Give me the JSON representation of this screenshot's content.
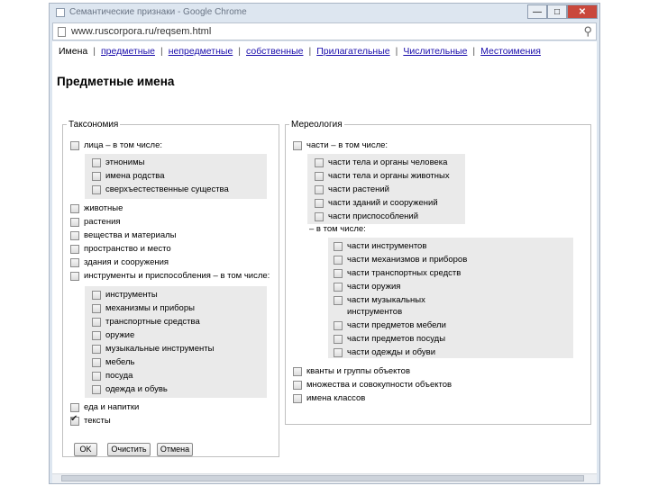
{
  "window": {
    "title": "Семантические признаки - Google Chrome",
    "controls": {
      "minimize": "—",
      "maximize": "□",
      "close": "✕"
    }
  },
  "urlbar": {
    "url": "www.ruscorpora.ru/reqsem.html"
  },
  "nav": {
    "current": "Имена",
    "links": [
      "предметные",
      "непредметные",
      "собственные",
      "Прилагательные",
      "Числительные",
      "Местоимения"
    ],
    "separator": "|"
  },
  "page_title": "Предметные имена",
  "taxonomy": {
    "legend": "Таксономия",
    "items": [
      {
        "label": "лица – в том числе:",
        "checked": false,
        "children": [
          "этнонимы",
          "имена родства",
          "сверхъестественные существа"
        ]
      },
      {
        "label": "животные",
        "checked": false
      },
      {
        "label": "растения",
        "checked": false
      },
      {
        "label": "вещества и материалы",
        "checked": false
      },
      {
        "label": "пространство и место",
        "checked": false
      },
      {
        "label": "здания и сооружения",
        "checked": false
      },
      {
        "label": "инструменты и приспособления – в том числе:",
        "checked": false,
        "children": [
          "инструменты",
          "механизмы и приборы",
          "транспортные средства",
          "оружие",
          "музыкальные инструменты",
          "мебель",
          "посуда",
          "одежда и обувь"
        ]
      },
      {
        "label": "еда и напитки",
        "checked": false
      },
      {
        "label": "тексты",
        "checked": true
      }
    ]
  },
  "mereology": {
    "legend": "Мереология",
    "top_label": "части – в том числе:",
    "parts": [
      "части тела и органы человека",
      "части тела и органы животных",
      "части растений",
      "части зданий и сооружений",
      "части приспособлений"
    ],
    "tools_suffix": "– в том числе:",
    "tool_parts": [
      "части инструментов",
      "части механизмов и приборов",
      "части транспортных средств",
      "части оружия",
      "части музыкальных инструментов",
      "части предметов мебели",
      "части предметов посуды",
      "части одежды и обуви"
    ],
    "after": [
      "кванты и группы объектов",
      "множества и совокупности объектов",
      "имена классов"
    ]
  },
  "buttons": {
    "ok": "OK",
    "clear": "Очистить",
    "cancel": "Отмена"
  }
}
